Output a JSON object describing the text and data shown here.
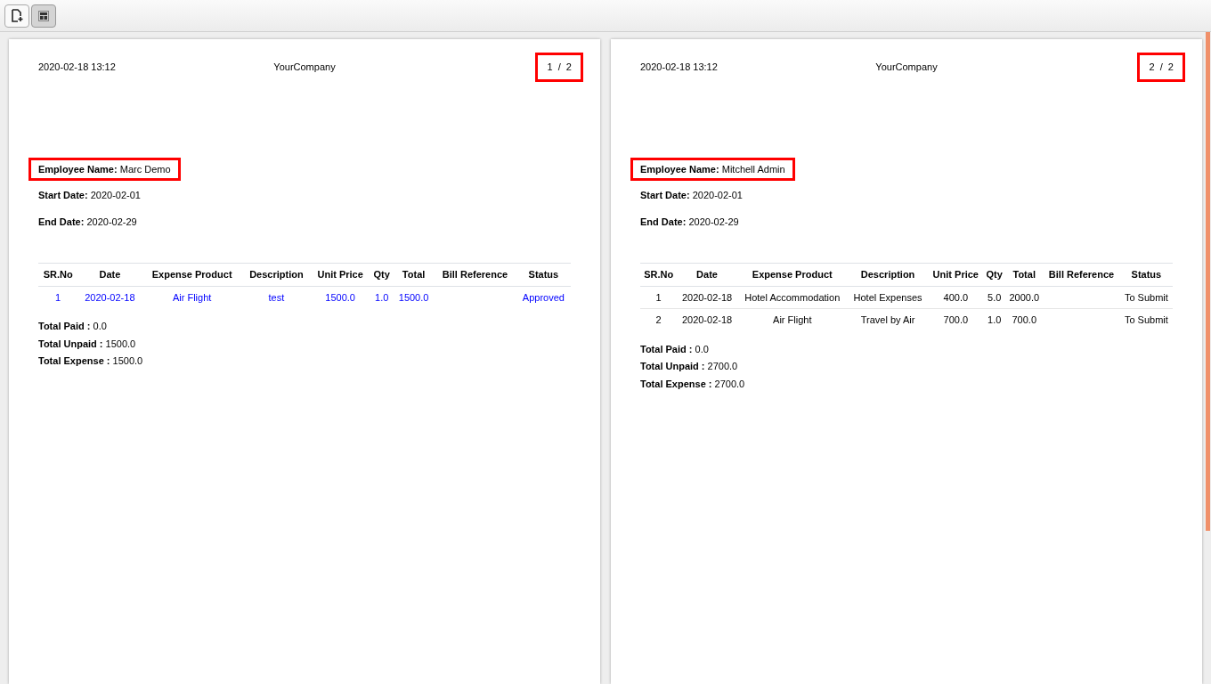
{
  "toolbar": {
    "buttons": [
      {
        "kind": "new",
        "selected": false
      },
      {
        "kind": "layout",
        "selected": true
      }
    ]
  },
  "pages": [
    {
      "datetime": "2020-02-18 13:12",
      "company": "YourCompany",
      "page_number": "1  /  2",
      "page_number_highlighted": true,
      "fields": [
        {
          "label": "Employee Name:",
          "value": "Marc Demo",
          "highlighted": true
        },
        {
          "label": "Start Date:",
          "value": "2020-02-01",
          "highlighted": false
        },
        {
          "label": "End Date:",
          "value": "2020-02-29",
          "highlighted": false
        }
      ],
      "columns": [
        "SR.No",
        "Date",
        "Expense Product",
        "Description",
        "Unit Price",
        "Qty",
        "Total",
        "Bill Reference",
        "Status"
      ],
      "rows": [
        {
          "color": "#0000ff",
          "cells": [
            "1",
            "2020-02-18",
            "Air Flight",
            "test",
            "1500.0",
            "1.0",
            "1500.0",
            "",
            "Approved"
          ]
        }
      ],
      "totals": [
        {
          "label": "Total Paid :",
          "value": "0.0"
        },
        {
          "label": "Total Unpaid :",
          "value": "1500.0"
        },
        {
          "label": "Total Expense :",
          "value": "1500.0"
        }
      ]
    },
    {
      "datetime": "2020-02-18 13:12",
      "company": "YourCompany",
      "page_number": "2  /  2",
      "page_number_highlighted": true,
      "fields": [
        {
          "label": "Employee Name:",
          "value": "Mitchell Admin",
          "highlighted": true
        },
        {
          "label": "Start Date:",
          "value": "2020-02-01",
          "highlighted": false
        },
        {
          "label": "End Date:",
          "value": "2020-02-29",
          "highlighted": false
        }
      ],
      "columns": [
        "SR.No",
        "Date",
        "Expense Product",
        "Description",
        "Unit Price",
        "Qty",
        "Total",
        "Bill Reference",
        "Status"
      ],
      "rows": [
        {
          "color": "#000000",
          "cells": [
            "1",
            "2020-02-18",
            "Hotel Accommodation",
            "Hotel Expenses",
            "400.0",
            "5.0",
            "2000.0",
            "",
            "To Submit"
          ]
        },
        {
          "color": "#000000",
          "cells": [
            "2",
            "2020-02-18",
            "Air Flight",
            "Travel by Air",
            "700.0",
            "1.0",
            "700.0",
            "",
            "To Submit"
          ]
        }
      ],
      "totals": [
        {
          "label": "Total Paid :",
          "value": "0.0"
        },
        {
          "label": "Total Unpaid :",
          "value": "2700.0"
        },
        {
          "label": "Total Expense :",
          "value": "2700.0"
        }
      ]
    }
  ]
}
